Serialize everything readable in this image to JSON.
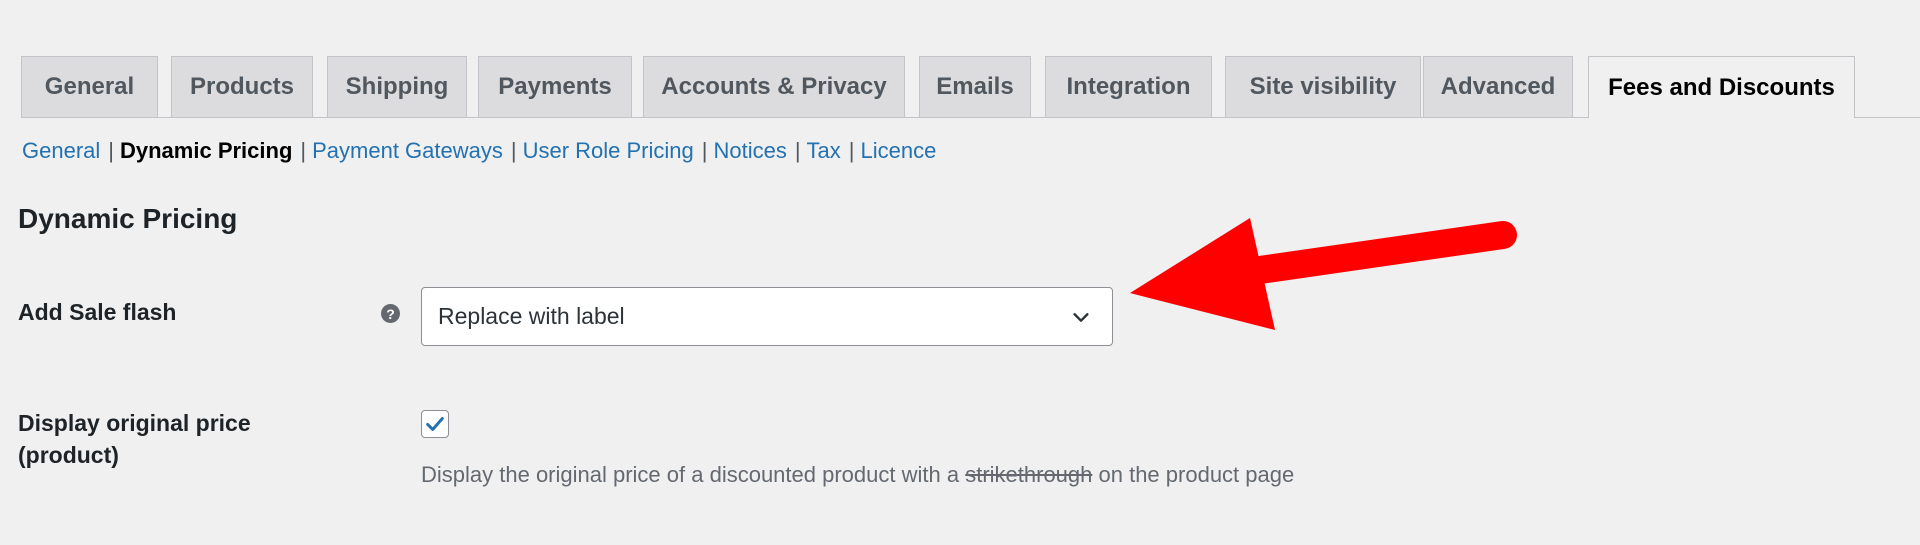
{
  "tabs": [
    {
      "label": "General"
    },
    {
      "label": "Products"
    },
    {
      "label": "Shipping"
    },
    {
      "label": "Payments"
    },
    {
      "label": "Accounts & Privacy"
    },
    {
      "label": "Emails"
    },
    {
      "label": "Integration"
    },
    {
      "label": "Site visibility"
    },
    {
      "label": "Advanced"
    },
    {
      "label": "Fees and Discounts",
      "active": true
    }
  ],
  "subnav": [
    {
      "label": "General"
    },
    {
      "label": "Dynamic Pricing",
      "current": true
    },
    {
      "label": "Payment Gateways"
    },
    {
      "label": "User Role Pricing"
    },
    {
      "label": "Notices"
    },
    {
      "label": "Tax"
    },
    {
      "label": "Licence"
    }
  ],
  "subnav_separator": "|",
  "section": {
    "title": "Dynamic Pricing"
  },
  "fields": {
    "sale_flash": {
      "label": "Add Sale flash",
      "help_icon": "?",
      "selected": "Replace with label"
    },
    "original_price": {
      "label_line1": "Display original price",
      "label_line2": "(product)",
      "checked": true,
      "desc_before": "Display the original price of a discounted product with a ",
      "desc_strike": "strikethrough",
      "desc_after": " on the product page"
    }
  },
  "icons": {
    "help": "question-circle-icon",
    "chevron": "chevron-down-icon",
    "check": "checkmark-icon",
    "annotation": "red-arrow-annotation"
  },
  "colors": {
    "background": "#f0f0f1",
    "link": "#2271b1",
    "tab_inactive": "#dcdcde",
    "checkmark": "#2271b1",
    "annotation_arrow": "#ff0000"
  }
}
